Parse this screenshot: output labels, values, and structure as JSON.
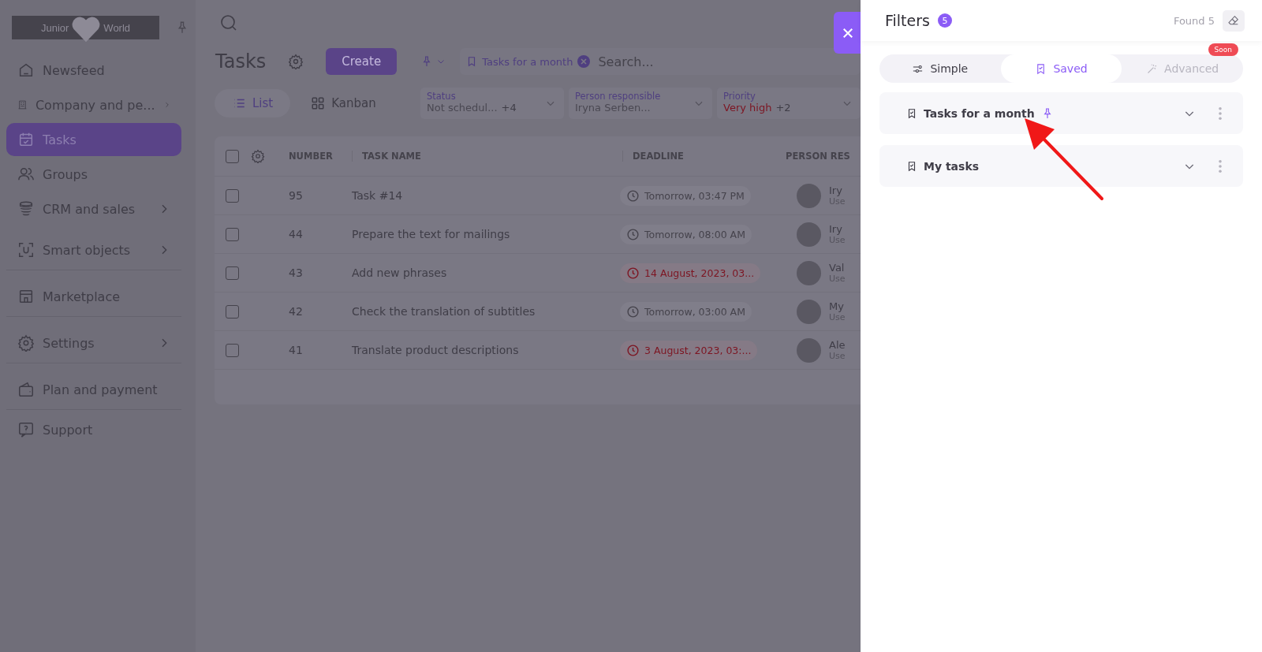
{
  "logo": {
    "left_word": "Junior",
    "right_word": "World"
  },
  "sidebar": {
    "items": [
      {
        "label": "Newsfeed",
        "expandable": false,
        "selected": false,
        "divider_after": false
      },
      {
        "label": "Company and pe...",
        "expandable": true,
        "selected": false,
        "divider_after": false
      },
      {
        "label": "Tasks",
        "expandable": false,
        "selected": true,
        "divider_after": false
      },
      {
        "label": "Groups",
        "expandable": false,
        "selected": false,
        "divider_after": false
      },
      {
        "label": "CRM and sales",
        "expandable": true,
        "selected": false,
        "divider_after": false
      },
      {
        "label": "Smart objects",
        "expandable": true,
        "selected": false,
        "divider_after": true
      },
      {
        "label": "Marketplace",
        "expandable": false,
        "selected": false,
        "divider_after": true
      },
      {
        "label": "Settings",
        "expandable": true,
        "selected": false,
        "divider_after": true
      },
      {
        "label": "Plan and payment",
        "expandable": false,
        "selected": false,
        "divider_after": true
      },
      {
        "label": "Support",
        "expandable": false,
        "selected": false,
        "divider_after": false
      }
    ]
  },
  "page": {
    "title": "Tasks",
    "create_button": "Create",
    "views": [
      {
        "label": "List",
        "selected": true
      },
      {
        "label": "Kanban",
        "selected": false
      }
    ],
    "search": {
      "chip": "Tasks for a month",
      "placeholder": "Search..."
    },
    "filters": [
      {
        "label": "Status",
        "value": "Not schedul...",
        "extra": "+4",
        "urgent": false
      },
      {
        "label": "Person responsible",
        "value": "Iryna Serben...",
        "urgent": false
      },
      {
        "label": "Priority",
        "value": "Very high",
        "extra": "+2",
        "urgent": true
      }
    ]
  },
  "table": {
    "all_selected": false,
    "columns": [
      "NUMBER",
      "TASK NAME",
      "DEADLINE",
      "PERSON RES"
    ],
    "rows": [
      {
        "number": "95",
        "name": "Task #14",
        "deadline": "Tomorrow, 03:47 PM",
        "overdue": false,
        "person": "Iry",
        "role": "Use",
        "checked": false
      },
      {
        "number": "44",
        "name": "Prepare the text for mailings",
        "deadline": "Tomorrow, 08:00 AM",
        "overdue": false,
        "person": "Iry",
        "role": "Use",
        "checked": false
      },
      {
        "number": "43",
        "name": "Add new phrases",
        "deadline": "14 August, 2023, 03...",
        "overdue": true,
        "person": "Val",
        "role": "Use",
        "checked": false
      },
      {
        "number": "42",
        "name": "Check the translation of subtitles",
        "deadline": "Tomorrow, 03:00 AM",
        "overdue": false,
        "person": "My",
        "role": "Use",
        "checked": false
      },
      {
        "number": "41",
        "name": "Translate product descriptions",
        "deadline": "3 August, 2023, 03:...",
        "overdue": true,
        "person": "Ale",
        "role": "Use",
        "checked": false
      }
    ]
  },
  "filters_panel": {
    "title": "Filters",
    "count": "5",
    "found": "Found 5",
    "tabs": [
      {
        "label": "Simple",
        "selected": false,
        "disabled": false
      },
      {
        "label": "Saved",
        "selected": true,
        "disabled": false
      },
      {
        "label": "Advanced",
        "selected": false,
        "disabled": true,
        "badge": "Soon"
      }
    ],
    "saved": [
      {
        "name": "Tasks for a month",
        "pinned": true
      },
      {
        "name": "My tasks",
        "pinned": false
      }
    ]
  }
}
